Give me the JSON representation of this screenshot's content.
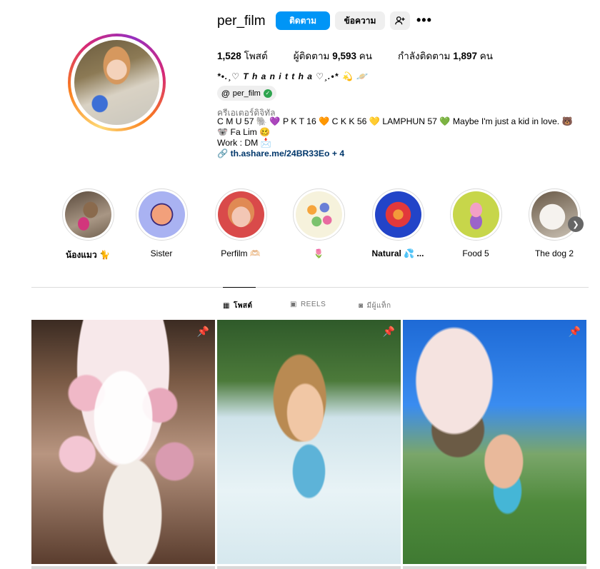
{
  "profile": {
    "username": "per_film",
    "follow_label": "ติดตาม",
    "message_label": "ข้อความ",
    "add_user_icon": "person-add-icon",
    "more_label": "•••"
  },
  "stats": {
    "posts_count": "1,528",
    "posts_label": "โพสต์",
    "followers_label": "ผู้ติดตาม",
    "followers_count": "9,593",
    "followers_unit": "คน",
    "following_label": "กำลังติดตาม",
    "following_count": "1,897",
    "following_unit": "คน"
  },
  "bio": {
    "name": "*•.¸♡ T h a n i t t h a ♡¸.•* 💫 🪐",
    "threads_handle": "per_film",
    "category": "ครีเอเตอร์ดิจิทัล",
    "text": "C M U 57 🐘 💜 P K T 16 🧡 C K K 56 💛 LAMPHUN 57 💚 Maybe I'm just a kid in love. 🐻 🐨 Fa Lim 🥴",
    "work": "Work : DM 📩",
    "link": "th.ashare.me/24BR33Eo + 4"
  },
  "highlights": [
    {
      "label": "น้องแมว 🐈",
      "bold": true
    },
    {
      "label": "Sister",
      "bold": false
    },
    {
      "label": "Perfilm 🫶🏻",
      "bold": false
    },
    {
      "label": "🌷",
      "bold": false
    },
    {
      "label": "Natural 💦 ...",
      "bold": true
    },
    {
      "label": "Food 5",
      "bold": false
    },
    {
      "label": "The dog 2",
      "bold": false
    }
  ],
  "tabs": {
    "posts": "โพสต์",
    "reels": "REELS",
    "tagged": "มีผู้แท็ก"
  },
  "colors": {
    "primary_button": "#0095f6",
    "secondary_button": "#efefef",
    "link": "#00376b"
  }
}
